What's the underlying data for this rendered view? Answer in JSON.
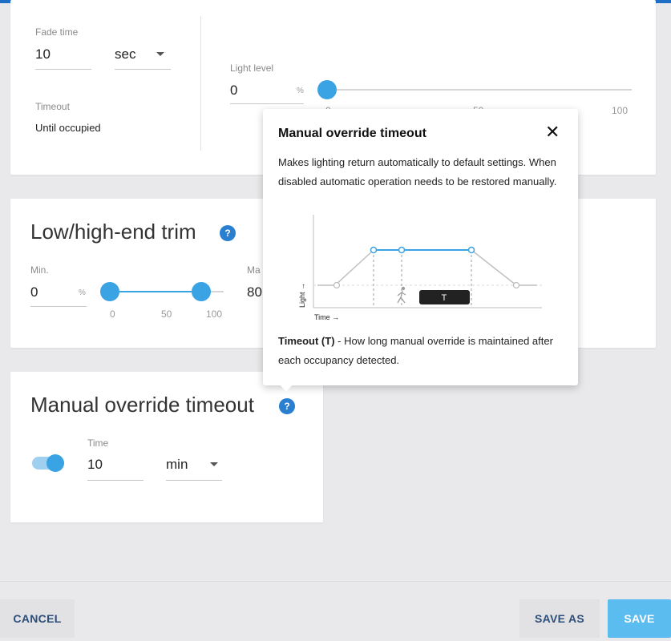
{
  "fade": {
    "label": "Fade time",
    "value": "10",
    "unit": "sec"
  },
  "timeout": {
    "label": "Timeout",
    "value": "Until occupied"
  },
  "light_level": {
    "label": "Light level",
    "value": "0",
    "unit": "%",
    "ticks": [
      "0",
      "50",
      "100"
    ],
    "level_percent": 0
  },
  "trim": {
    "title": "Low/high-end trim",
    "min_label": "Min.",
    "min_value": "0",
    "min_unit": "%",
    "max_label": "Ma",
    "max_value": "80",
    "ticks": [
      "0",
      "50",
      "100"
    ]
  },
  "override": {
    "title": "Manual override timeout",
    "toggle_on": true,
    "time_label": "Time",
    "time_value": "10",
    "time_unit": "min"
  },
  "popover": {
    "title": "Manual override timeout",
    "close_glyph": "✕",
    "body": "Makes lighting return automatically to default settings. When disabled automatic operation needs to be restored manually.",
    "diagram_ylabel": "Light →",
    "diagram_xlabel": "Time →",
    "diagram_t_badge": "T",
    "footer_bold": "Timeout (T)",
    "footer_text": " - How long manual override is maintained after each occupancy detected."
  },
  "help_glyph": "?",
  "buttons": {
    "cancel": "CANCEL",
    "save_as": "SAVE AS",
    "save": "SAVE"
  },
  "colors": {
    "accent": "#3aa3e3",
    "help_icon": "#2b7fd0",
    "top_bar": "#1f6fc7"
  }
}
